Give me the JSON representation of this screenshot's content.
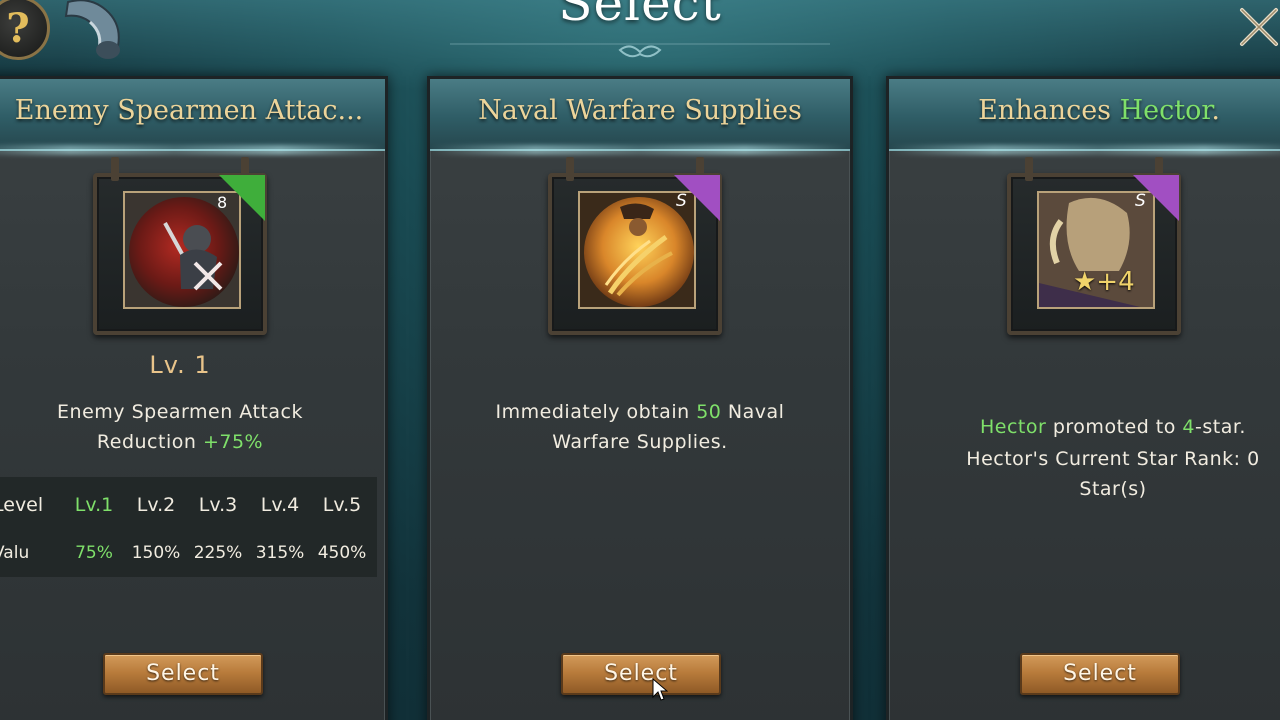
{
  "screen": {
    "title": "Select"
  },
  "top_bar": {
    "help_label": "?"
  },
  "cards": [
    {
      "title": "Enemy Spearmen Attac...",
      "badge": "8",
      "badge_color": "#3fae3b",
      "icon": "spearmen-debuff-icon",
      "level": "Lv. 1",
      "desc_lines": [
        "Enemy Spearmen Attack",
        "Reduction "
      ],
      "desc_value": "+75%",
      "table": {
        "row_label_level": "Level",
        "row_label_value": "Valu",
        "levels": [
          "Lv.1",
          "Lv.2",
          "Lv.3",
          "Lv.4",
          "Lv.5"
        ],
        "values": [
          "75%",
          "150%",
          "225%",
          "315%",
          "450%"
        ],
        "active_index": 0
      },
      "button": "Select"
    },
    {
      "title": "Naval Warfare Supplies",
      "badge": "S",
      "badge_color": "#a14fc2",
      "icon": "wheat-supplies-icon",
      "desc_a": "Immediately obtain ",
      "desc_num": "50",
      "desc_b": " Naval",
      "desc_line2": "Warfare Supplies.",
      "button": "Select"
    },
    {
      "title_a": "Enhances ",
      "title_hero": "Hector",
      "title_b": ".",
      "badge": "S",
      "badge_color": "#a14fc2",
      "icon": "hector-portrait-icon",
      "star_overlay": "★+4",
      "desc_hero": "Hector",
      "desc_mid": " promoted to ",
      "desc_star": "4",
      "desc_end": "-star.",
      "desc_line2": "Hector's Current Star Rank: 0",
      "desc_line3": "Star(s)",
      "button": "Select"
    }
  ],
  "colors": {
    "title_gold": "#ecd49a",
    "highlight_green": "#7fe06a",
    "button_bronze": "#b97c3c"
  }
}
